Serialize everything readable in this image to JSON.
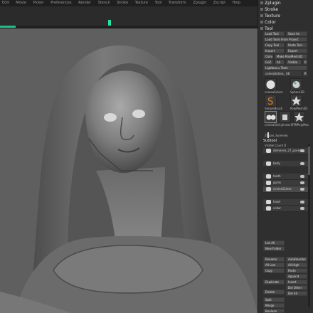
{
  "menubar": [
    "Edit",
    "Movie",
    "Picker",
    "Preferences",
    "Render",
    "Stencil",
    "Stroke",
    "Texture",
    "Tool",
    "Transform",
    "Zplugin",
    "Zscript",
    "Help"
  ],
  "progress": 0.06,
  "panel": {
    "menus": [
      "Zplugin",
      "Stroke",
      "Texture",
      "Color",
      "Tool"
    ],
    "buttons": {
      "load_tool": "Load Tool",
      "save_as": "Save As",
      "load_tools_from_project": "Load Tools From Project",
      "copy_tool": "Copy Tool",
      "paste_tool": "Paste Tool",
      "import": "Import",
      "export": "Export",
      "clone": "Clone",
      "make_polymesh": "Make PolyMesh3D",
      "goz": "GoZ",
      "all": "All",
      "visible": "Visible",
      "r": "R",
      "lightbox_tools": "Lightbox ▸ Tools",
      "current_tool": "cenieaSclera_ 48",
      "r2": "R"
    },
    "tools": [
      {
        "name": "cenieaSclera",
        "icon": "sphere"
      },
      {
        "name": "Sphere3D",
        "icon": "sphere"
      },
      {
        "name": "SimpleBrush",
        "icon": "s-brush"
      },
      {
        "name": "PolyMesh3D",
        "icon": "star"
      },
      {
        "name": "cenieaSclera",
        "icon": "sphere"
      },
      {
        "name": "Cylinder3D",
        "icon": "cylinder"
      },
      {
        "name": "TMPolyMesh_1",
        "icon": "star"
      },
      {
        "name": "ZHuan_Sumesec",
        "icon": "figure"
      }
    ],
    "subtool_header": "Subtool",
    "visible_count": "Visible Count 8",
    "subtools": [
      {
        "name": "demense_27_posed"
      },
      {
        "name": "body"
      },
      {
        "name": "teeth"
      },
      {
        "name": "gums"
      },
      {
        "name": "cenieaSclera"
      },
      {
        "name": "hood"
      },
      {
        "name": "collar"
      }
    ],
    "list_buttons": {
      "list_all": "List All",
      "new_folder": "New Folder",
      "rename": "Rename",
      "autoreorder": "AutoReorder",
      "all_low": "All Low",
      "all_high": "All High",
      "copy": "Copy",
      "paste": "Paste",
      "append": "Append",
      "duplicate": "Duplicate",
      "insert": "Insert",
      "del_other": "Del Other",
      "delete": "Delete",
      "del_all": "Del All",
      "split": "Split",
      "merge": "Merge",
      "boolean": "Boolean"
    }
  },
  "colors": {
    "accent": "#1fbf86",
    "background": "#2a2a2a",
    "viewport": "#5c5c5c"
  }
}
